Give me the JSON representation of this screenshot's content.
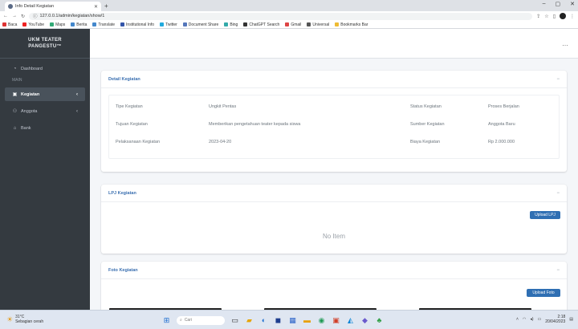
{
  "browser": {
    "tab_title": "Info Detail Kegiatan",
    "url": "127.0.0.1/admin/kegiatan/show/1",
    "bookmarks": [
      {
        "label": "Baca",
        "color": "#d33"
      },
      {
        "label": "YouTube",
        "color": "#e22"
      },
      {
        "label": "Maps",
        "color": "#3a7"
      },
      {
        "label": "Berita",
        "color": "#48c"
      },
      {
        "label": "Translate",
        "color": "#48c"
      },
      {
        "label": "Institutional Info",
        "color": "#35a"
      },
      {
        "label": "Twitter",
        "color": "#2ad"
      },
      {
        "label": "Document Share",
        "color": "#57b"
      },
      {
        "label": "Bing",
        "color": "#3aa"
      },
      {
        "label": "ChatGPT Search",
        "color": "#333"
      },
      {
        "label": "Gmail",
        "color": "#d44"
      },
      {
        "label": "Universal",
        "color": "#555"
      },
      {
        "label": "Bookmarks Bar",
        "color": "#eb3"
      }
    ]
  },
  "sidebar": {
    "brand_line1": "UKM TEATER",
    "brand_line2": "PANGESTU™",
    "items": [
      {
        "label": "Dashboard",
        "icon": "speedometer-icon",
        "glyph": "◔",
        "active": false,
        "arrow": ""
      },
      {
        "label": "Kegiatan",
        "icon": "document-icon",
        "glyph": "▣",
        "active": true,
        "arrow": "‹"
      },
      {
        "label": "Anggota",
        "icon": "users-icon",
        "glyph": "⚇",
        "active": false,
        "arrow": "‹"
      },
      {
        "label": "Bank",
        "icon": "bank-icon",
        "glyph": "⌂",
        "active": false,
        "arrow": ""
      }
    ],
    "section_label": "MAIN"
  },
  "topbar": {
    "user_label": "…"
  },
  "detail_card": {
    "title": "Detail Kegiatan",
    "rows": [
      {
        "label": "Tipe Kegiatan",
        "value": "Ungkit Pentas",
        "label2": "Status Kegiatan",
        "value2": "Proses Berjalan"
      },
      {
        "label": "Tujuan Kegiatan",
        "value": "Memberikan pengetahuan teater kepada siswa",
        "label2": "Sumber Kegiatan",
        "value2": "Anggota Baru"
      },
      {
        "label": "Pelaksanaan Kegiatan",
        "value": "2023-04-20",
        "label2": "Biaya Kegiatan",
        "value2": "Rp 2.000.000"
      }
    ]
  },
  "lpj_card": {
    "title": "LPJ Kegiatan",
    "button": "Upload LPJ",
    "empty": "No Item"
  },
  "foto_card": {
    "title": "Foto Kegiatan",
    "button": "Upload Foto"
  },
  "taskbar": {
    "weather_temp": "31°C",
    "weather_text": "Sebagian cerah",
    "search": "Cari",
    "time": "2:18",
    "date": "20/04/2023"
  }
}
